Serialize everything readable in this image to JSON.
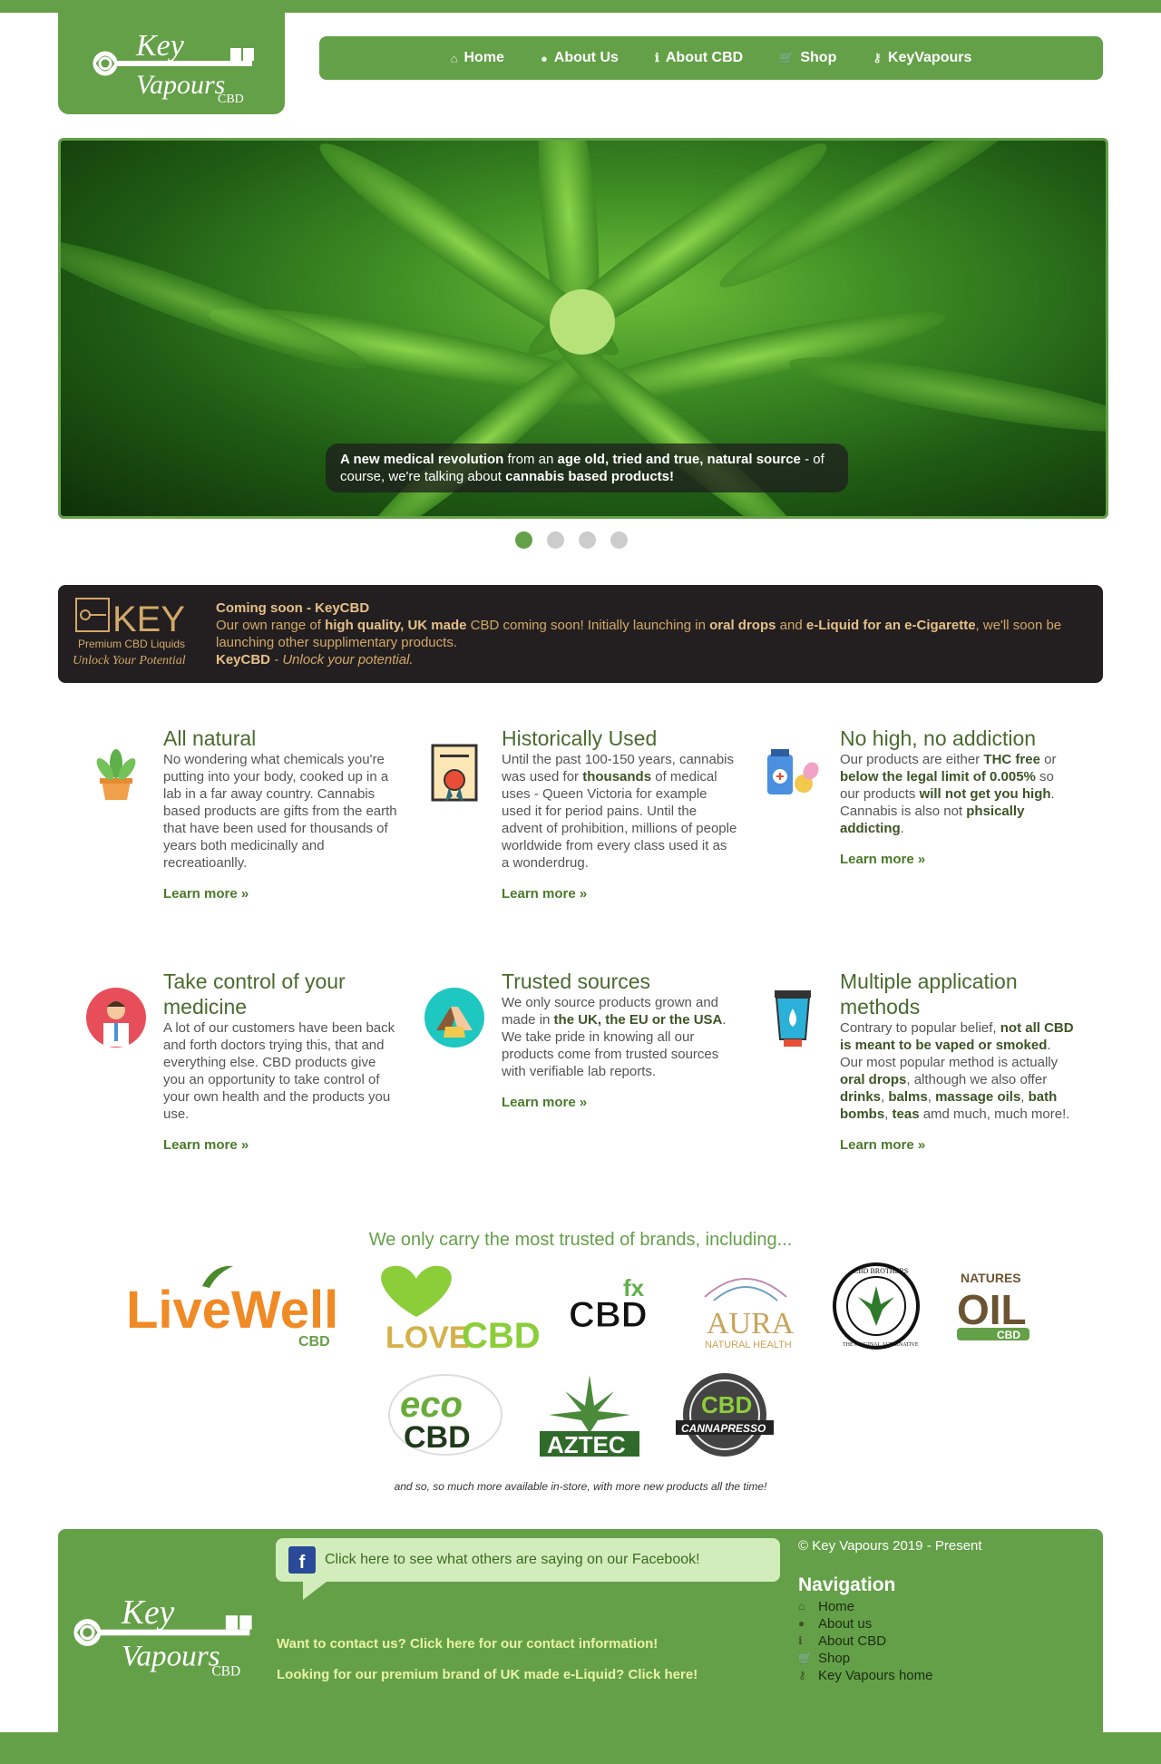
{
  "header": {
    "logo_alt": "Key Vapours CBD",
    "logo_word1": "Key",
    "logo_word2": "Vapours",
    "logo_word3": "CBD",
    "nav": [
      {
        "label": "Home",
        "icon": "home-icon"
      },
      {
        "label": "About Us",
        "icon": "user-icon"
      },
      {
        "label": "About CBD",
        "icon": "info-icon"
      },
      {
        "label": "Shop",
        "icon": "cart-icon"
      },
      {
        "label": "KeyVapours",
        "icon": "key-icon"
      }
    ]
  },
  "hero": {
    "caption_bold1": "A new medical revolution",
    "caption_text1": " from an ",
    "caption_bold2": "age old, tried and true, natural source",
    "caption_text2": " - of course, we're talking about ",
    "caption_bold3": "cannabis based products!",
    "slides_count": 4,
    "active_slide": 1
  },
  "promo": {
    "logo_word": "KEY",
    "logo_sub": "Premium CBD Liquids",
    "logo_tag": "Unlock Your Potential",
    "title": "Coming soon - KeyCBD",
    "line_a": "Our own range of ",
    "bold_a": "high quality, UK made",
    "line_b": " CBD coming soon! Initially launching in ",
    "bold_b": "oral drops",
    "line_c": " and ",
    "bold_c": "e-Liquid for an e-Cigarette",
    "line_d": ", we'll soon be launching other supplimentary products.",
    "sig_bold": "KeyCBD",
    "sig_text": " - Unlock your potential."
  },
  "features": [
    {
      "title": "All natural",
      "icon": "plant-pot-icon",
      "text": "No wondering what chemicals you're putting into your body, cooked up in a lab in a far away country. Cannabis based products are gifts from the earth that have been used for thousands of years both medicinally and recreatioanlly.",
      "learn": "Learn more »"
    },
    {
      "title": "Historically Used",
      "icon": "certificate-icon",
      "text_parts": [
        "Until the past 100-150 years, cannabis was used for ",
        "thousands",
        " of medical uses - Queen Victoria for example used it for period pains. Until the advent of prohibition, millions of people worldwide from every class used it as a wonderdrug."
      ],
      "learn": "Learn more »"
    },
    {
      "title": "No high, no addiction",
      "icon": "pills-icon",
      "text_parts": [
        "Our products are either ",
        "THC free",
        " or ",
        "below the legal limit of 0.005%",
        " so our products ",
        "will not get you high",
        ". Cannabis is also not ",
        "phsically addicting",
        "."
      ],
      "learn": "Learn more »"
    },
    {
      "title": "Take control of your medicine",
      "icon": "doctor-icon",
      "text": "A lot of our customers have been back and forth doctors trying this, that and everything else. CBD products give you an opportunity to take control of your own health and the products you use.",
      "learn": "Learn more »"
    },
    {
      "title": "Trusted sources",
      "icon": "handshake-icon",
      "text_parts": [
        "We only source products grown and made in ",
        "the UK, the EU or the USA",
        ". We take pride in knowing all our products come from trusted sources with verifiable lab reports."
      ],
      "learn": "Learn more »"
    },
    {
      "title": "Multiple application methods",
      "icon": "tube-icon",
      "text_parts": [
        "Contrary to popular belief, ",
        "not all CBD is meant to be vaped or smoked",
        ". Our most popular method is actually ",
        "oral drops",
        ", although we also offer ",
        "drinks",
        ", ",
        "balms",
        ", ",
        "massage oils",
        ", ",
        "bath bombs",
        ", ",
        "teas",
        " amd much, much more!."
      ],
      "learn": "Learn more »"
    }
  ],
  "brands": {
    "title": "We only carry the most trusted of brands, including...",
    "row1": [
      {
        "name": "LiveWell CBD",
        "main": "LiveWell",
        "sub": "CBD"
      },
      {
        "name": "Love CBD",
        "main": "LOVE",
        "sub": "CBD"
      },
      {
        "name": "CBD fx",
        "main": "CBD",
        "sub": "fx"
      },
      {
        "name": "Aura Natural Health",
        "main": "AURA",
        "sub": "NATURAL HEALTH"
      },
      {
        "name": "CBD Brothers",
        "main": "CBD BROTHERS",
        "sub": "THE ORIGINAL ALTERNATIVE"
      },
      {
        "name": "Natures Oil CBD",
        "main": "OIL",
        "sub": "NATURES",
        "sub2": "CBD"
      }
    ],
    "row2": [
      {
        "name": "eco CBD",
        "main": "eco",
        "sub": "CBD"
      },
      {
        "name": "Aztec",
        "main": "AZTEC"
      },
      {
        "name": "CBD Cannapresso",
        "main": "CBD",
        "sub": "CANNAPRESSO"
      }
    ],
    "note": "and so, so much more available in-store, with more new products all the time!"
  },
  "footer": {
    "facebook": "Click here to see what others are saying on our Facebook!",
    "contact": "Want to contact us? Click here for our contact information!",
    "premium": "Looking for our premium brand of UK made e-Liquid? Click here!",
    "copyright": "© Key Vapours 2019 - Present",
    "nav_title": "Navigation",
    "nav": [
      {
        "label": "Home",
        "icon": "home-icon"
      },
      {
        "label": "About us",
        "icon": "user-icon"
      },
      {
        "label": "About CBD",
        "icon": "info-icon"
      },
      {
        "label": "Shop",
        "icon": "cart-icon"
      },
      {
        "label": "Key Vapours home",
        "icon": "key-icon"
      }
    ]
  },
  "colors": {
    "brand": "#64a048",
    "dark": "#231f20",
    "gold": "#d2a869"
  }
}
